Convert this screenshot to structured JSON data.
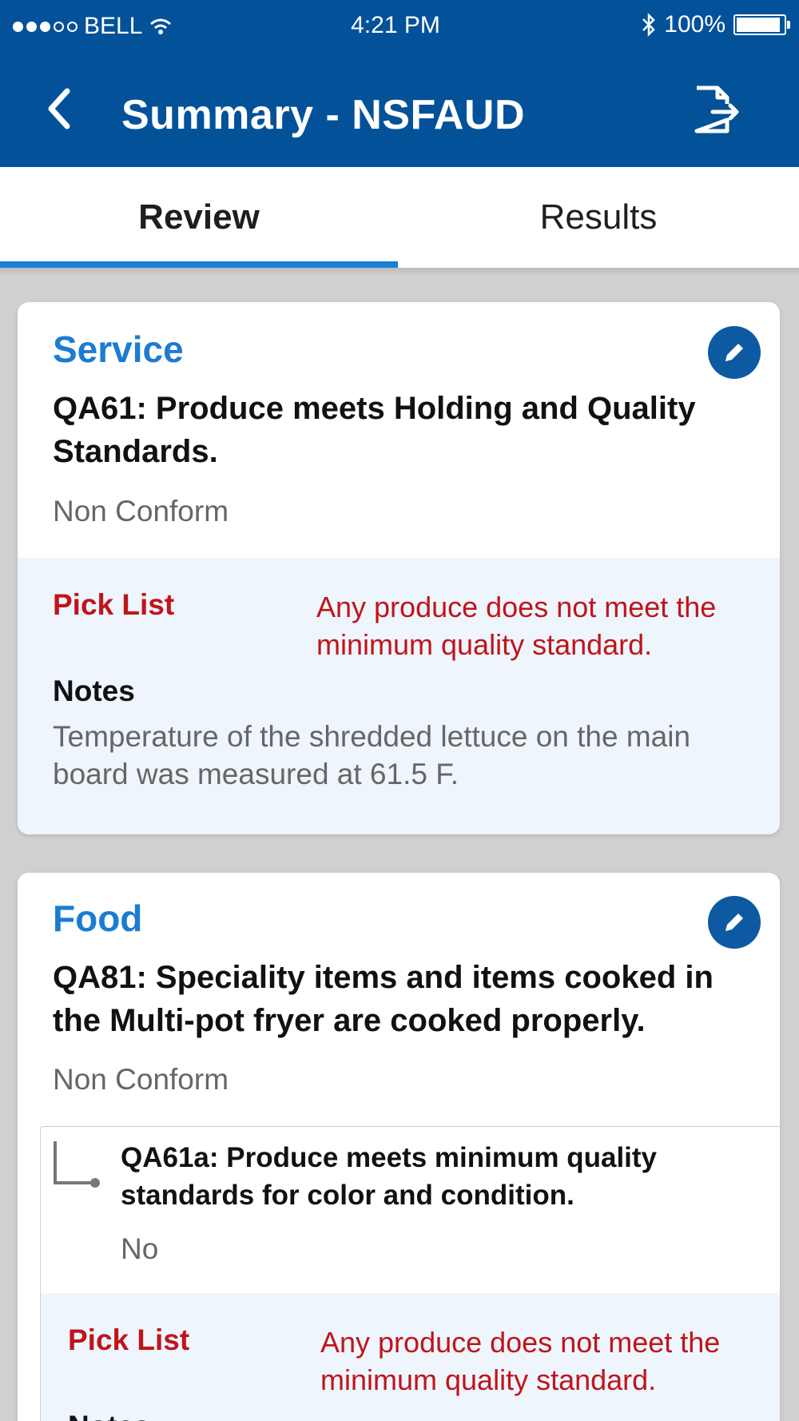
{
  "status_bar": {
    "carrier": "BELL",
    "time": "4:21 PM",
    "battery": "100%",
    "battery_level": 1.0
  },
  "header": {
    "title": "Summary - NSFAUD"
  },
  "tabs": [
    {
      "label": "Review",
      "selected": true
    },
    {
      "label": "Results",
      "selected": false
    }
  ],
  "colors": {
    "header_bg": "#035299",
    "accent": "#1b7fd4",
    "error": "#c0141b"
  },
  "cards": [
    {
      "category": "Service",
      "question": "QA61: Produce meets Holding and Quality Standards.",
      "status": "Non Conform",
      "pick_list_label": "Pick List",
      "pick_list_value": "Any produce does not meet the minimum quality standard.",
      "notes_label": "Notes",
      "notes_value": "Temperature of the shredded lettuce on the main board was measured at 61.5 F."
    },
    {
      "category": "Food",
      "question": "QA81: Speciality items and items cooked in the Multi-pot fryer are cooked properly.",
      "status": "Non Conform",
      "sub_item": {
        "question": "QA61a: Produce meets minimum quality standards for color and condition.",
        "status": "No",
        "pick_list_label": "Pick List",
        "pick_list_value": "Any produce does not meet the minimum quality standard.",
        "notes_label": "Notes"
      }
    }
  ]
}
